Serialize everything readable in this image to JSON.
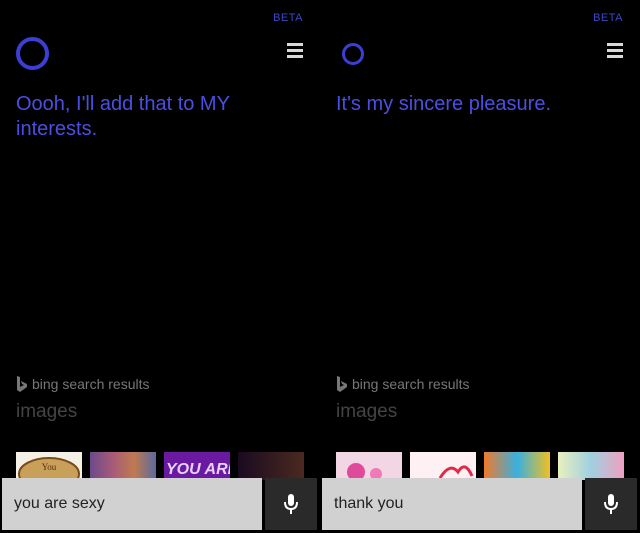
{
  "panels": [
    {
      "beta": "BETA",
      "response": "Oooh, I'll add that to MY interests.",
      "bing_label": "bing search results",
      "images_label": "images",
      "query": "you are sexy",
      "thumbs": [
        "You",
        "",
        "YOU ARE",
        ""
      ]
    },
    {
      "beta": "BETA",
      "response": "It's my sincere pleasure.",
      "bing_label": "bing search results",
      "images_label": "images",
      "query": "thank you",
      "thumbs": [
        "",
        "",
        "",
        ""
      ]
    }
  ],
  "colors": {
    "accent": "#3b3fd6",
    "response_text": "#4b4fe0",
    "background": "#000000",
    "query_box": "#d1d1d1"
  },
  "icons": [
    "cortana-circle-icon",
    "hamburger-menu-icon",
    "bing-logo-icon",
    "microphone-icon"
  ]
}
